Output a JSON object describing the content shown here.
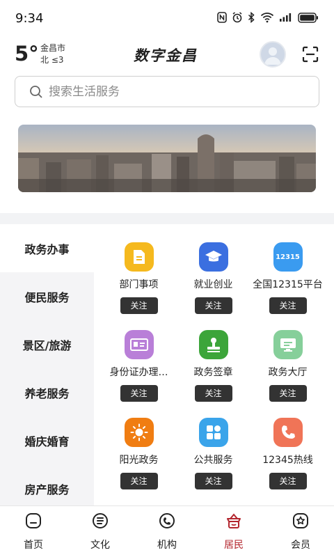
{
  "status_bar": {
    "time": "9:34"
  },
  "header": {
    "temperature": "5°",
    "city": "金昌市",
    "wind": "北 ≤3",
    "brand": "数字金昌"
  },
  "search": {
    "placeholder": "搜索生活服务"
  },
  "sidebar": {
    "items": [
      {
        "label": "政务办事",
        "active": true
      },
      {
        "label": "便民服务",
        "active": false
      },
      {
        "label": "景区/旅游",
        "active": false
      },
      {
        "label": "养老服务",
        "active": false
      },
      {
        "label": "婚庆婚育",
        "active": false
      },
      {
        "label": "房产服务",
        "active": false
      }
    ]
  },
  "services": {
    "follow_label": "关注",
    "items": [
      {
        "label": "部门事项",
        "icon": "document-icon",
        "color": "#f5b91e"
      },
      {
        "label": "就业创业",
        "icon": "graduation-cap-icon",
        "color": "#3b6fe0"
      },
      {
        "label": "全国12315平台",
        "icon": "12315-badge-icon",
        "icon_text": "12315",
        "color": "#3a9bf0"
      },
      {
        "label": "身份证办理…",
        "icon": "id-card-icon",
        "color": "#b97fd8"
      },
      {
        "label": "政务签章",
        "icon": "stamp-icon",
        "color": "#3ca53a"
      },
      {
        "label": "政务大厅",
        "icon": "monitor-icon",
        "color": "#86cf9a"
      },
      {
        "label": "阳光政务",
        "icon": "sun-icon",
        "color": "#f07d12"
      },
      {
        "label": "公共服务",
        "icon": "blocks-icon",
        "color": "#3aa4ea"
      },
      {
        "label": "12345热线",
        "icon": "phone-icon",
        "color": "#f07457"
      }
    ]
  },
  "bottom_nav": {
    "items": [
      {
        "label": "首页",
        "icon": "home-icon",
        "active": false
      },
      {
        "label": "文化",
        "icon": "culture-icon",
        "active": false
      },
      {
        "label": "机构",
        "icon": "institution-icon",
        "active": false
      },
      {
        "label": "居民",
        "icon": "resident-icon",
        "active": true
      },
      {
        "label": "会员",
        "icon": "member-icon",
        "active": false
      }
    ]
  },
  "colors": {
    "accent": "#b3262e",
    "follow_button": "#333333",
    "sidebar_bg": "#f4f4f6"
  }
}
